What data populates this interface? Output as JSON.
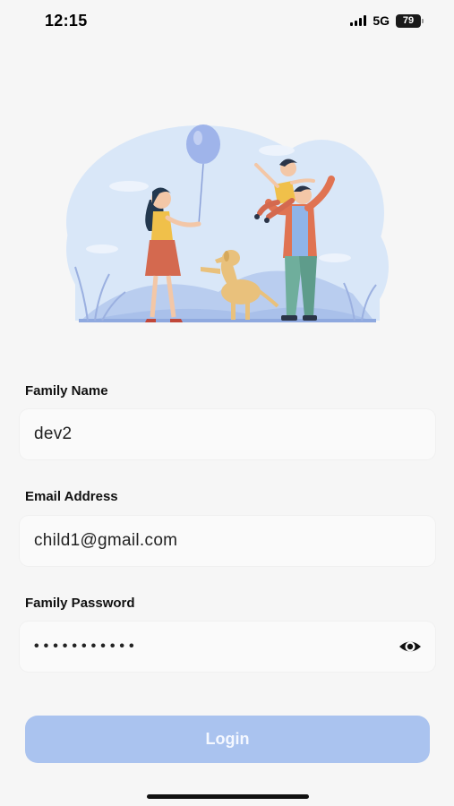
{
  "status_bar": {
    "time": "12:15",
    "network": "5G",
    "battery": "79",
    "icons": [
      "signal-bars-icon",
      "battery-icon"
    ]
  },
  "hero": {
    "illustration": "family-illustration",
    "colors": {
      "backdrop": "#d8e6f8",
      "balloon": "#9fb4ea",
      "dog": "#e9c17c",
      "dress": "#d4694f",
      "jacket": "#e07352"
    }
  },
  "form": {
    "family_name": {
      "label": "Family Name",
      "value": "dev2"
    },
    "email": {
      "label": "Email Address",
      "value": "child1@gmail.com"
    },
    "password": {
      "label": "Family Password",
      "value": "•••••••••••",
      "toggle_icon": "eye-icon"
    }
  },
  "login_button": {
    "label": "Login",
    "color": "#aac3ef"
  }
}
